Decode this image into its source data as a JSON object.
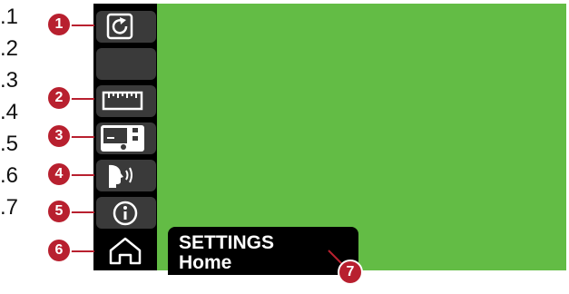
{
  "row_labels": [
    ".1",
    ".2",
    ".3",
    ".4",
    ".5",
    ".6",
    ".7"
  ],
  "callouts": [
    "1",
    "2",
    "3",
    "4",
    "5",
    "6",
    "7"
  ],
  "sidebar": {
    "items": [
      {
        "icon": "refresh-icon"
      },
      {
        "icon": "blank"
      },
      {
        "icon": "ruler-icon"
      },
      {
        "icon": "monitor-icon"
      },
      {
        "icon": "voice-icon"
      },
      {
        "icon": "info-icon"
      }
    ],
    "home": {
      "icon": "home-icon"
    }
  },
  "status": {
    "title": "SETTINGS",
    "subtitle": "Home"
  },
  "colors": {
    "screen": "#63bc45",
    "callout": "#b8202f",
    "panel": "#000000",
    "button": "#3a3a3a"
  }
}
